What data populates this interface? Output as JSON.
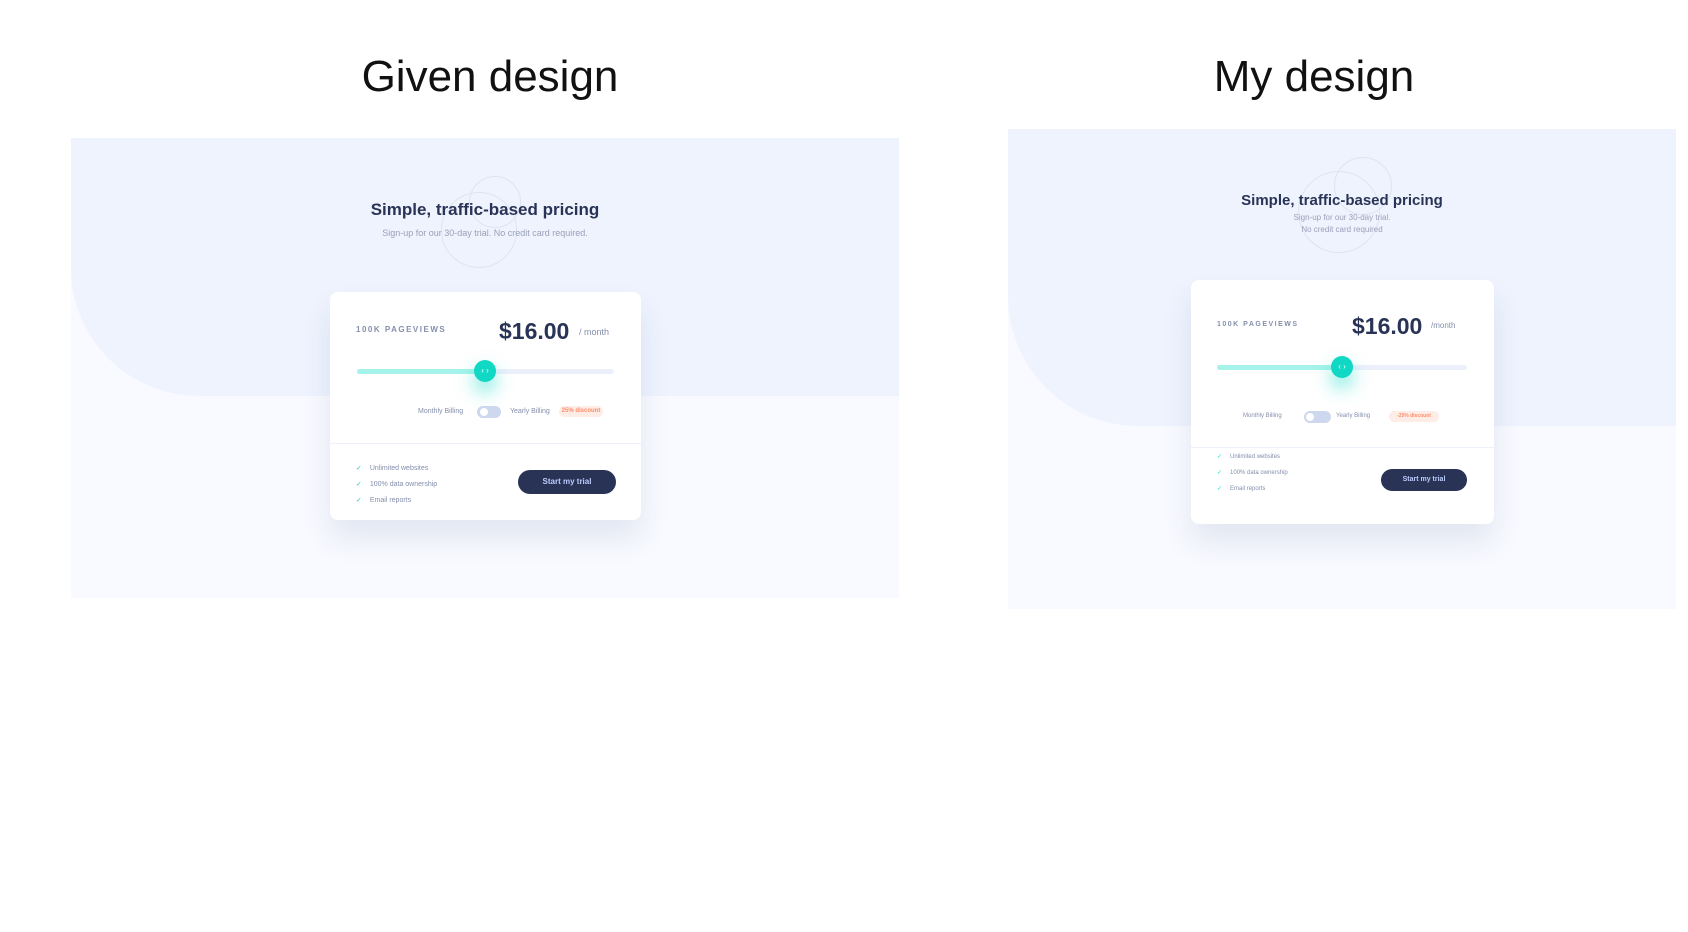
{
  "titles": {
    "left": "Given design",
    "right": "My design"
  },
  "colors": {
    "accent": "#10d8c4",
    "slider_fill": "#a5f3eb",
    "navy": "#293356",
    "muted": "#858fad",
    "bg_top": "#eef3fe",
    "bg_bottom": "#f8faff",
    "discount_bg": "#feece7",
    "discount_text": "#ff8d68"
  },
  "given": {
    "heading": "Simple, traffic-based pricing",
    "subtitle": "Sign-up for our 30-day trial. No credit card required.",
    "pageviews": "100K PAGEVIEWS",
    "price": "$16.00",
    "period": "/ month",
    "slider_value_fraction": 0.5,
    "monthly_label": "Monthly Billing",
    "yearly_label": "Yearly Billing",
    "discount": "25% discount",
    "features": [
      "Unlimited websites",
      "100% data ownership",
      "Email reports"
    ],
    "cta": "Start my trial"
  },
  "mine": {
    "heading": "Simple, traffic-based pricing",
    "subtitle_line1": "Sign-up for our 30-day trial.",
    "subtitle_line2": "No credit card required",
    "pageviews": "100K PAGEVIEWS",
    "price": "$16.00",
    "period": "/month",
    "slider_value_fraction": 0.5,
    "monthly_label": "Monthly Billing",
    "yearly_label": "Yearly Billing",
    "discount": "-25% discount",
    "features": [
      "Unlimited websites",
      "100% data ownership",
      "Email reports"
    ],
    "cta": "Start my trial"
  },
  "icons": {
    "check": "check-icon",
    "thumb": "slider-arrows-icon"
  }
}
